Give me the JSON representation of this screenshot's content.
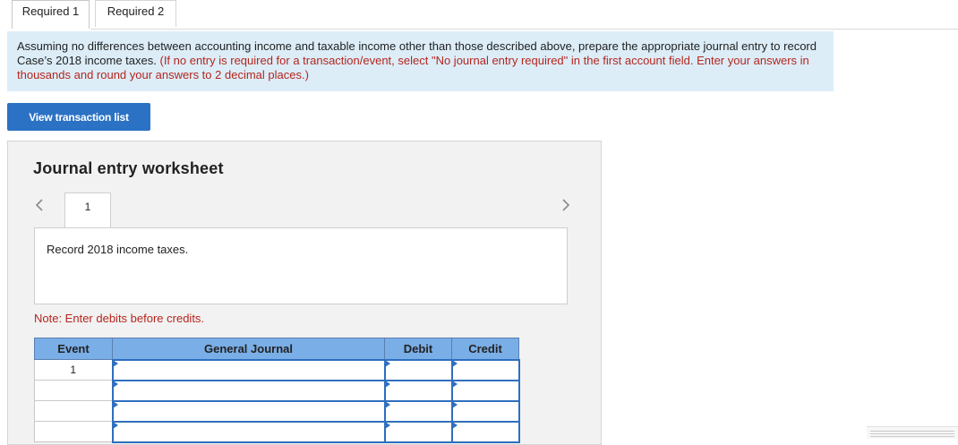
{
  "tabs": [
    {
      "label": "Required 1",
      "active": true
    },
    {
      "label": "Required 2",
      "active": false
    }
  ],
  "instructions": {
    "text": "Assuming no differences between accounting income and taxable income other than those described above, prepare the appropriate journal entry to record Case’s 2018 income taxes.",
    "note": "(If no entry is required for a transaction/event, select \"No journal entry required\" in the first account field. Enter your answers in thousands and round your answers to 2 decimal places.)"
  },
  "buttons": {
    "view_transactions": "View transaction list"
  },
  "worksheet": {
    "title": "Journal entry worksheet",
    "current_entry": "1",
    "description": "Record 2018 income taxes.",
    "note": "Note: Enter debits before credits.",
    "columns": [
      "Event",
      "General Journal",
      "Debit",
      "Credit"
    ],
    "rows": [
      {
        "event": "1",
        "account": "",
        "debit": "",
        "credit": ""
      },
      {
        "event": "",
        "account": "",
        "debit": "",
        "credit": ""
      },
      {
        "event": "",
        "account": "",
        "debit": "",
        "credit": ""
      },
      {
        "event": "",
        "account": "",
        "debit": "",
        "credit": ""
      }
    ]
  },
  "colors": {
    "accent": "#2b72c4",
    "instruction_bg": "#dcedf8",
    "warning_text": "#b5261e",
    "table_header": "#7aaee6"
  }
}
